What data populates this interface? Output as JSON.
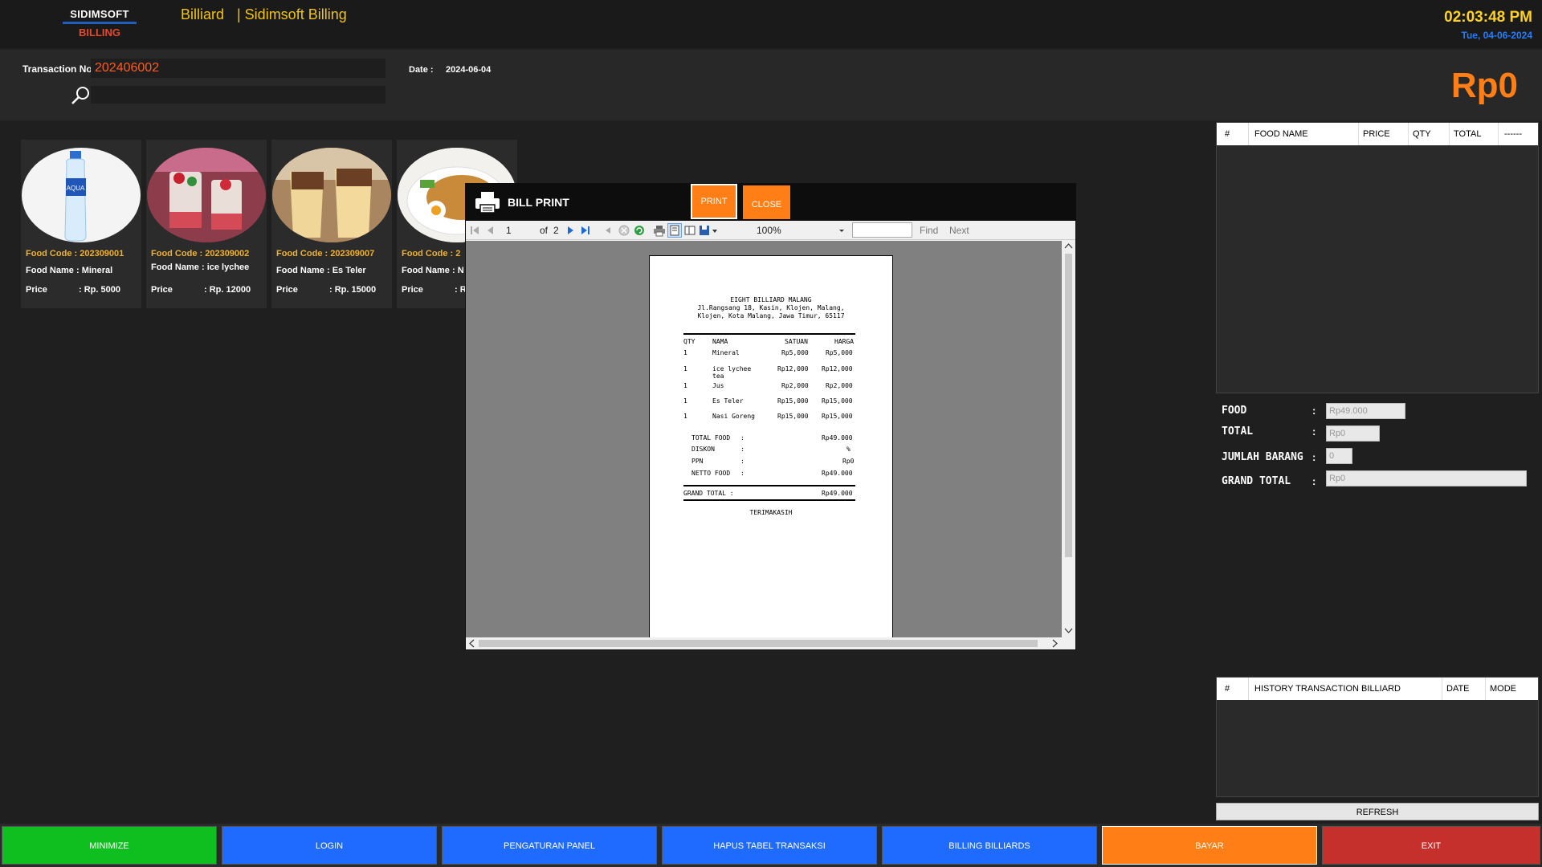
{
  "header": {
    "logo_line1": "SIDIMSOFT",
    "logo_line2": "BILLING",
    "app_name": "Billiard",
    "app_subtitle": "| Sidimsoft Billing",
    "time": "02:03:48 PM",
    "date": "Tue, 04-06-2024"
  },
  "transaction": {
    "label": "Transaction No",
    "number": "202406002",
    "date_label": "Date :",
    "date_value": "2024-06-04",
    "total_display": "Rp0"
  },
  "foods": [
    {
      "code_label": "Food Code",
      "code": ": 202309001",
      "name_label": "Food Name",
      "name": ": Mineral",
      "price_label": "Price",
      "price": ": Rp. 5000"
    },
    {
      "code_label": "Food Code",
      "code": ": 202309002",
      "name_label": "Food Name",
      "name": ": ice lychee",
      "price_label": "Price",
      "price": ": Rp. 12000"
    },
    {
      "code_label": "Food Code",
      "code": ": 202309007",
      "name_label": "Food Name",
      "name": ": Es Teler",
      "price_label": "Price",
      "price": ": Rp. 15000"
    },
    {
      "code_label": "Food Code",
      "code": ": 2",
      "name_label": "Food Name",
      "name": ": N",
      "price_label": "Price",
      "price": ": R"
    }
  ],
  "food_grid": {
    "columns": [
      "#",
      "FOOD NAME",
      "PRICE",
      "QTY",
      "TOTAL",
      "------"
    ]
  },
  "summary": {
    "food_label": "FOOD",
    "food_value": "Rp49.000",
    "total_label": "TOTAL",
    "total_value": "Rp0",
    "items_label": "JUMLAH BARANG",
    "items_value": "0",
    "grand_label": "GRAND TOTAL",
    "grand_value": "Rp0",
    "colon": ":"
  },
  "history_grid": {
    "columns": [
      "#",
      "HISTORY TRANSACTION BILLIARD",
      "DATE",
      "MODE"
    ]
  },
  "refresh_label": "REFRESH",
  "buttons": {
    "minimize": "MINIMIZE",
    "login": "LOGIN",
    "settings": "PENGATURAN PANEL",
    "delete": "HAPUS TABEL TRANSAKSI",
    "billing": "BILLING BILLIARDS",
    "pay": "BAYAR",
    "exit": "EXIT"
  },
  "dialog": {
    "title": "BILL PRINT",
    "print": "PRINT",
    "close": "CLOSE",
    "toolbar": {
      "page": "1",
      "of": "of",
      "total_pages": "2",
      "zoom": "100%",
      "find": "Find",
      "next": "Next"
    },
    "receipt": {
      "store": "EIGHT BILLIARD MALANG",
      "address1": "Jl.Rangsang 18, Kasin, Klojen, Malang,",
      "address2": "Klojen, Kota Malang, Jawa Timur, 65117",
      "col_qty": "QTY",
      "col_name": "NAMA",
      "col_unit": "SATUAN",
      "col_amount": "HARGA",
      "items": [
        {
          "qty": "1",
          "name": "Mineral",
          "unit": "Rp5,000",
          "amount": "Rp5,000"
        },
        {
          "qty": "1",
          "name": "ice lychee",
          "name2": "tea",
          "unit": "Rp12,000",
          "amount": "Rp12,000"
        },
        {
          "qty": "1",
          "name": "Jus",
          "unit": "Rp2,000",
          "amount": "Rp2,000"
        },
        {
          "qty": "1",
          "name": "Es Teler",
          "unit": "Rp15,000",
          "amount": "Rp15,000"
        },
        {
          "qty": "1",
          "name": "Nasi Goreng",
          "unit": "Rp15,000",
          "amount": "Rp15,000"
        }
      ],
      "total_food_label": "TOTAL FOOD",
      "total_food": "Rp49.000",
      "discount_label": "DISKON",
      "discount": "%",
      "ppn_label": "PPN",
      "ppn": "Rp0",
      "netto_label": "NETTO FOOD",
      "netto": "Rp49.000",
      "grand_label": "GRAND TOTAL :",
      "grand": "Rp49.000",
      "thanks": "TERIMAKASIH",
      "colon": ":"
    }
  },
  "colors": {
    "accent_orange": "#ff7f16",
    "clock_yellow": "#ffd21f",
    "date_blue": "#1f7fff",
    "btn_green": "#0fbf1f",
    "btn_blue": "#1f6bff",
    "btn_red": "#c5302c"
  }
}
